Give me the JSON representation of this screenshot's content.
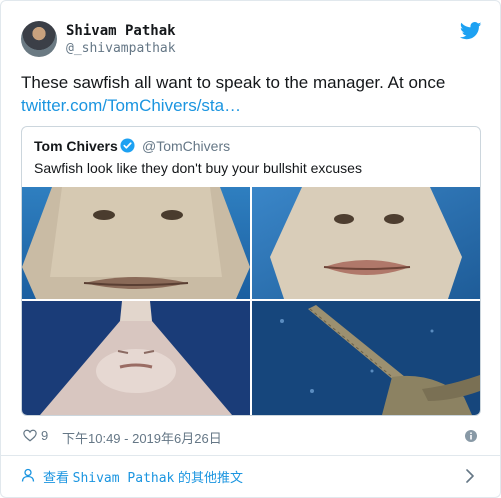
{
  "tweet": {
    "author_name": "Shivam Pathak",
    "author_handle": "@_shivampathak",
    "text": "These sawfish all want to speak to the manager. At once",
    "link_text": "twitter.com/TomChivers/sta…"
  },
  "quoted_tweet": {
    "author_name": "Tom Chivers",
    "author_handle": "@TomChivers",
    "text": "Sawfish look like they don't buy your bullshit excuses"
  },
  "meta": {
    "like_count": "9",
    "timestamp": "下午10:49 - 2019年6月26日"
  },
  "footer": {
    "prefix": "查看 ",
    "name": "Shivam Pathak",
    "suffix": " 的其他推文"
  },
  "icons": {
    "brand": "twitter-bird-icon",
    "verified": "verified-badge-icon",
    "like": "heart-icon",
    "info": "info-icon",
    "person": "person-icon",
    "chevron": "chevron-right-icon"
  },
  "colors": {
    "brand_blue": "#1da1f2",
    "link_blue": "#1b95e0",
    "secondary_text": "#657786"
  }
}
